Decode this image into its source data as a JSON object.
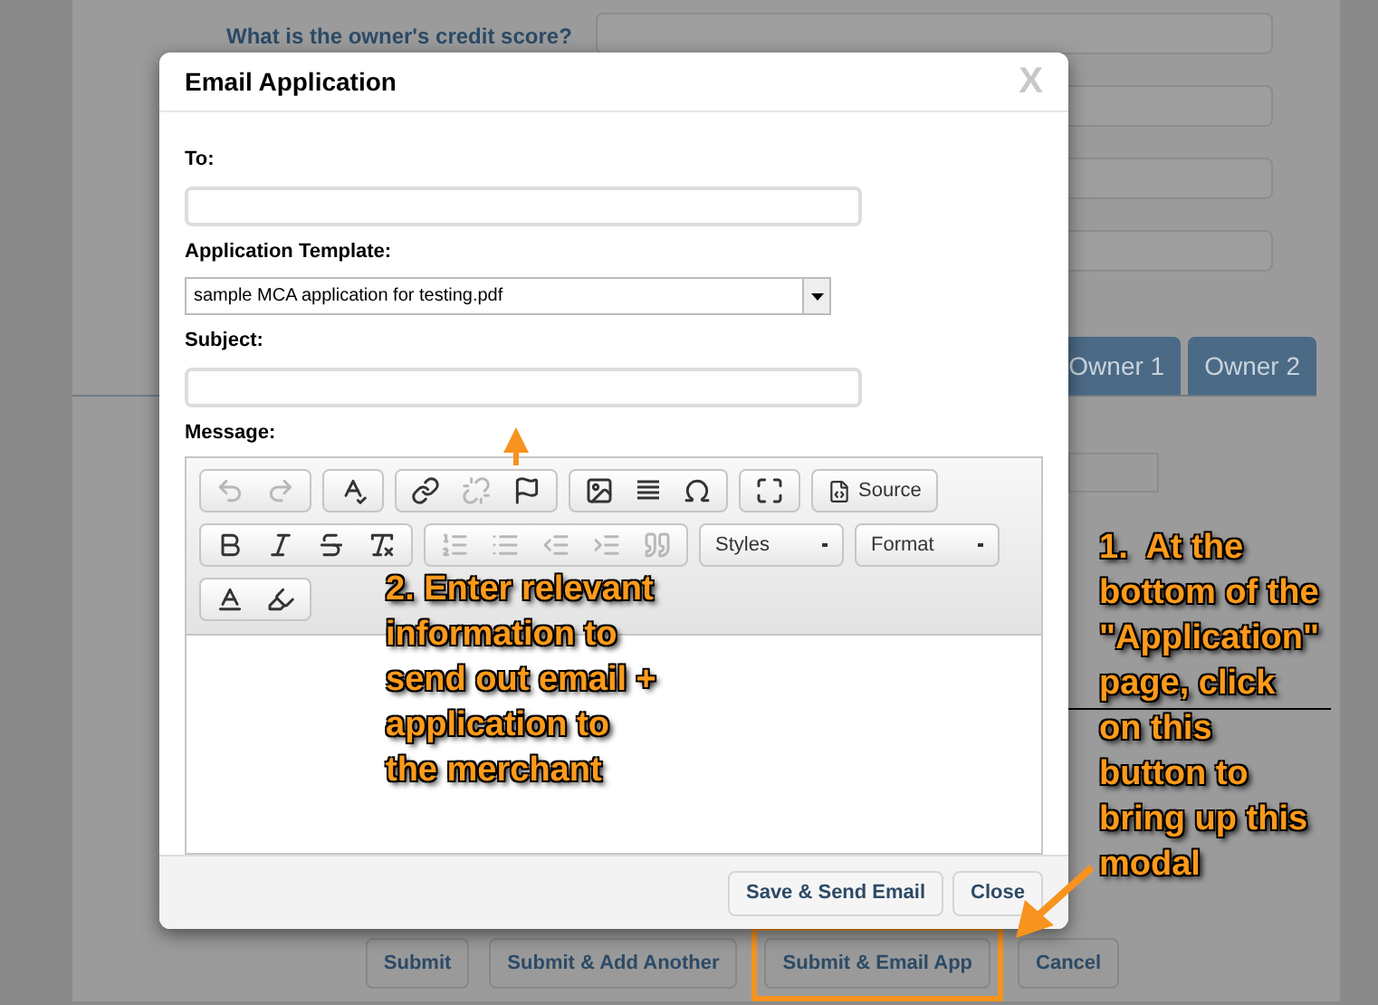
{
  "page": {
    "question": "What is the owner's credit score?",
    "tabs": [
      {
        "label": "Owner 1",
        "selected": false
      },
      {
        "label": "Owner 2",
        "selected": false
      }
    ],
    "buttons": [
      {
        "label": "Submit",
        "highlighted": false
      },
      {
        "label": "Submit & Add Another",
        "highlighted": false
      },
      {
        "label": "Submit & Email App",
        "highlighted": true
      },
      {
        "label": "Cancel",
        "highlighted": false
      }
    ]
  },
  "modal": {
    "title": "Email Application",
    "close": "X",
    "fields": [
      {
        "kind": "text",
        "label": "To:"
      },
      {
        "kind": "select",
        "label": "Application Template:",
        "value": "sample MCA application for testing.pdf"
      },
      {
        "kind": "text",
        "label": "Subject:"
      }
    ],
    "message_label": "Message:",
    "toolbar": {
      "source": "Source",
      "styles": "Styles",
      "format": "Format"
    },
    "buttons": [
      "Save & Send Email",
      "Close"
    ]
  },
  "annotations": [
    {
      "lines": [
        "2. Enter relevant",
        "information to",
        "send out email +",
        "application to",
        "the merchant"
      ]
    },
    {
      "lines": [
        "1.  At the",
        "bottom of the",
        "\"Application\"",
        "page, click",
        "on this",
        "button to",
        "bring up this",
        "modal"
      ]
    }
  ]
}
